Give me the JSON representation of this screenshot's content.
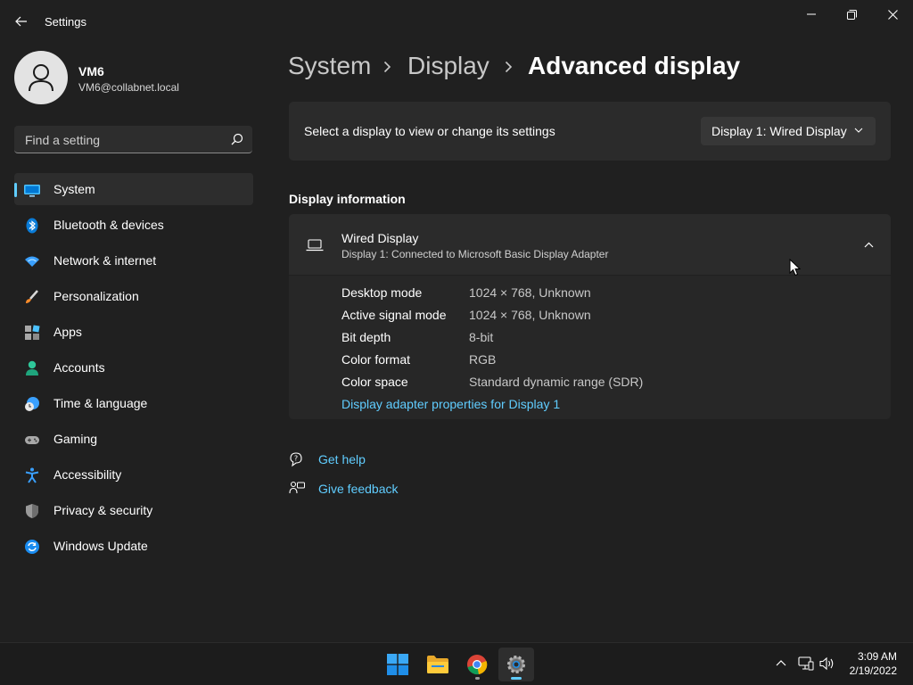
{
  "window": {
    "title": "Settings",
    "back_icon": "back-arrow-icon",
    "minimize_icon": "minimize-icon",
    "maximize_icon": "restore-icon",
    "close_icon": "close-icon"
  },
  "profile": {
    "name": "VM6",
    "email": "VM6@collabnet.local",
    "avatar_icon": "person-icon"
  },
  "search": {
    "placeholder": "Find a setting",
    "value": "",
    "icon": "search-icon"
  },
  "sidebar": {
    "items": [
      {
        "label": "System",
        "icon": "system-display-icon",
        "active": true
      },
      {
        "label": "Bluetooth & devices",
        "icon": "bluetooth-icon"
      },
      {
        "label": "Network & internet",
        "icon": "wifi-icon"
      },
      {
        "label": "Personalization",
        "icon": "paintbrush-icon"
      },
      {
        "label": "Apps",
        "icon": "apps-icon"
      },
      {
        "label": "Accounts",
        "icon": "account-icon"
      },
      {
        "label": "Time & language",
        "icon": "clock-globe-icon"
      },
      {
        "label": "Gaming",
        "icon": "gamepad-icon"
      },
      {
        "label": "Accessibility",
        "icon": "accessibility-icon"
      },
      {
        "label": "Privacy & security",
        "icon": "shield-icon"
      },
      {
        "label": "Windows Update",
        "icon": "update-icon"
      }
    ]
  },
  "breadcrumb": {
    "items": [
      "System",
      "Display",
      "Advanced display"
    ],
    "separator_icon": "chevron-right-icon"
  },
  "display_select": {
    "label": "Select a display to view or change its settings",
    "selected": "Display 1: Wired Display",
    "chevron_icon": "chevron-down-icon"
  },
  "display_info": {
    "section_title": "Display information",
    "device_icon": "laptop-icon",
    "title": "Wired Display",
    "subtitle": "Display 1: Connected to Microsoft Basic Display Adapter",
    "collapse_icon": "chevron-up-icon",
    "rows": [
      {
        "label": "Desktop mode",
        "value": "1024 × 768, Unknown"
      },
      {
        "label": "Active signal mode",
        "value": "1024 × 768, Unknown"
      },
      {
        "label": "Bit depth",
        "value": "8-bit"
      },
      {
        "label": "Color format",
        "value": "RGB"
      },
      {
        "label": "Color space",
        "value": "Standard dynamic range (SDR)"
      }
    ],
    "adapter_link": "Display adapter properties for Display 1"
  },
  "help": {
    "get_help": "Get help",
    "get_help_icon": "help-chat-icon",
    "give_feedback": "Give feedback",
    "give_feedback_icon": "feedback-icon"
  },
  "taskbar": {
    "apps": [
      {
        "name": "Start",
        "icon": "windows-start-icon"
      },
      {
        "name": "File Explorer",
        "icon": "folder-icon"
      },
      {
        "name": "Google Chrome",
        "icon": "chrome-icon"
      },
      {
        "name": "Settings",
        "icon": "gear-icon",
        "active": true
      }
    ],
    "tray_icons": [
      "chevron-up-icon",
      "network-icon",
      "volume-icon"
    ],
    "time": "3:09 AM",
    "date": "2/19/2022"
  },
  "colors": {
    "background": "#202020",
    "card": "#2b2b2b",
    "accent": "#60cdff",
    "text": "#ffffff"
  }
}
